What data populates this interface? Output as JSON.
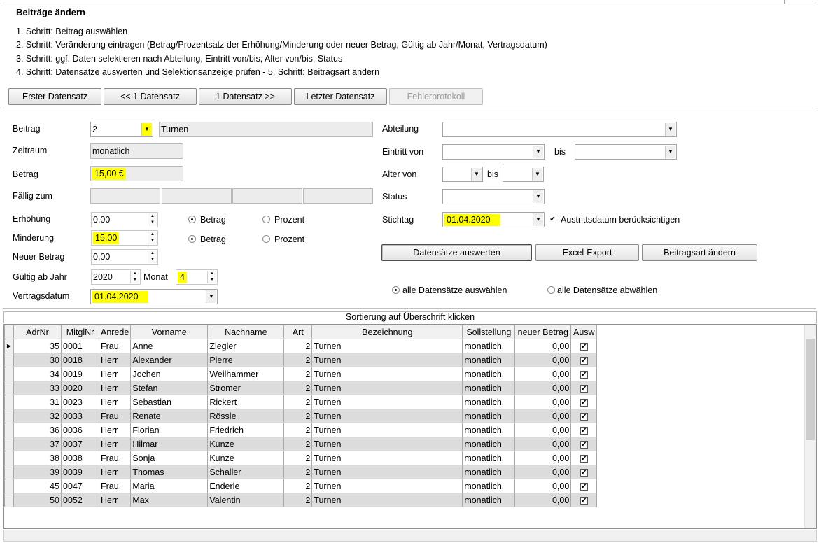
{
  "header": {
    "title": "Beiträge ändern",
    "steps": [
      "1. Schritt: Beitrag auswählen",
      "2. Schritt: Veränderung eintragen (Betrag/Prozentsatz der Erhöhung/Minderung oder neuer Betrag, Gültig ab Jahr/Monat, Vertragsdatum)",
      "3. Schritt: ggf. Daten selektieren nach Abteilung, Eintritt von/bis, Alter von/bis, Status",
      "4. Schritt: Datensätze auswerten und Selektionsanzeige prüfen - 5. Schritt: Beitragsart ändern"
    ]
  },
  "nav": {
    "first": "Erster Datensatz",
    "prev": "<< 1 Datensatz",
    "next": "1 Datensatz >>",
    "last": "Letzter Datensatz",
    "errors": "Fehlerprotokoll"
  },
  "form": {
    "beitrag_label": "Beitrag",
    "beitrag_value": "2",
    "beitrag_name": "Turnen",
    "zeitraum_label": "Zeitraum",
    "zeitraum_value": "monatlich",
    "betrag_label": "Betrag",
    "betrag_value": "15,00 €",
    "faellig_label": "Fällig zum",
    "erhoehung_label": "Erhöhung",
    "erhoehung_value": "0,00",
    "minderung_label": "Minderung",
    "minderung_value": "15,00",
    "neuer_betrag_label": "Neuer Betrag",
    "neuer_betrag_value": "0,00",
    "gueltig_label": "Gültig ab Jahr",
    "gueltig_value": "2020",
    "monat_label": "Monat",
    "monat_value": "4",
    "vertragsdatum_label": "Vertragsdatum",
    "vertragsdatum_value": "01.04.2020",
    "radio_betrag": "Betrag",
    "radio_prozent": "Prozent"
  },
  "selection": {
    "abteilung_label": "Abteilung",
    "eintritt_label": "Eintritt von",
    "bis_label": "bis",
    "alter_label": "Alter von",
    "status_label": "Status",
    "stichtag_label": "Stichtag",
    "stichtag_value": "01.04.2020",
    "austritt_label": "Austrittsdatum berücksichtigen"
  },
  "actions": {
    "auswerten": "Datensätze auswerten",
    "excel": "Excel-Export",
    "aendern": "Beitragsart ändern",
    "select_all": "alle Datensätze auswählen",
    "deselect_all": "alle Datensätze abwählen"
  },
  "grid": {
    "sort_hint": "Sortierung auf Überschrift klicken",
    "columns": [
      "AdrNr",
      "MitglNr",
      "Anrede",
      "Vorname",
      "Nachname",
      "Art",
      "Bezeichnung",
      "Sollstellung",
      "neuer Betrag",
      "Ausw"
    ],
    "rows": [
      [
        "35",
        "0001",
        "Frau",
        "Anne",
        "Ziegler",
        "2",
        "Turnen",
        "monatlich",
        "0,00"
      ],
      [
        "30",
        "0018",
        "Herr",
        "Alexander",
        "Pierre",
        "2",
        "Turnen",
        "monatlich",
        "0,00"
      ],
      [
        "34",
        "0019",
        "Herr",
        "Jochen",
        "Weilhammer",
        "2",
        "Turnen",
        "monatlich",
        "0,00"
      ],
      [
        "33",
        "0020",
        "Herr",
        "Stefan",
        "Stromer",
        "2",
        "Turnen",
        "monatlich",
        "0,00"
      ],
      [
        "31",
        "0023",
        "Herr",
        "Sebastian",
        "Rickert",
        "2",
        "Turnen",
        "monatlich",
        "0,00"
      ],
      [
        "32",
        "0033",
        "Frau",
        "Renate",
        "Rössle",
        "2",
        "Turnen",
        "monatlich",
        "0,00"
      ],
      [
        "36",
        "0036",
        "Herr",
        "Florian",
        "Friedrich",
        "2",
        "Turnen",
        "monatlich",
        "0,00"
      ],
      [
        "37",
        "0037",
        "Herr",
        "Hilmar",
        "Kunze",
        "2",
        "Turnen",
        "monatlich",
        "0,00"
      ],
      [
        "38",
        "0038",
        "Frau",
        "Sonja",
        "Kunze",
        "2",
        "Turnen",
        "monatlich",
        "0,00"
      ],
      [
        "39",
        "0039",
        "Herr",
        "Thomas",
        "Schaller",
        "2",
        "Turnen",
        "monatlich",
        "0,00"
      ],
      [
        "45",
        "0047",
        "Frau",
        "Maria",
        "Enderle",
        "2",
        "Turnen",
        "monatlich",
        "0,00"
      ],
      [
        "50",
        "0052",
        "Herr",
        "Max",
        "Valentin",
        "2",
        "Turnen",
        "monatlich",
        "0,00"
      ]
    ]
  },
  "colors": {
    "highlight": "#ffff00",
    "alt_row": "#dcdcdc"
  }
}
